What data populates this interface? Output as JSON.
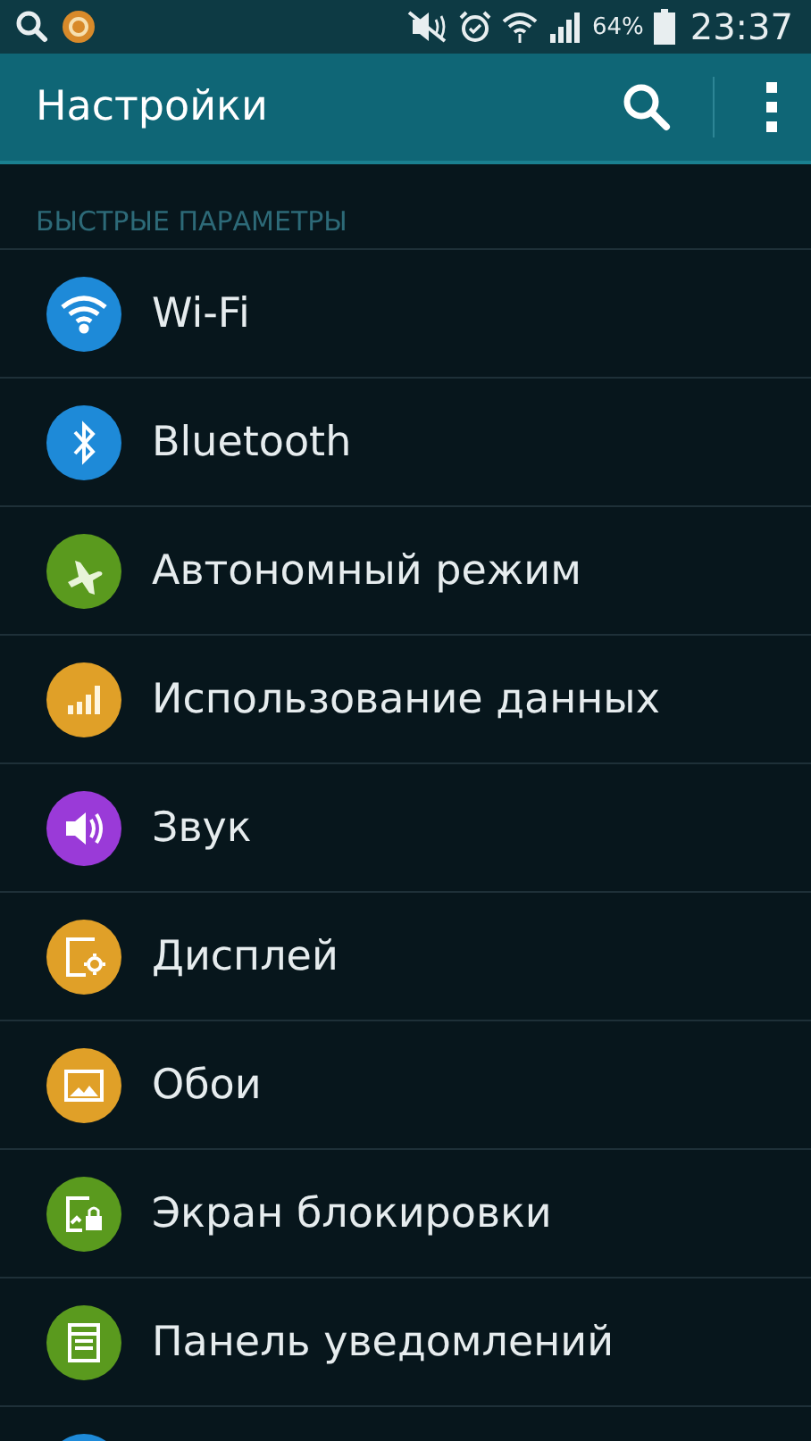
{
  "status_bar": {
    "battery_text": "64%",
    "time": "23:37"
  },
  "app_bar": {
    "title": "Настройки"
  },
  "section": {
    "title": "БЫСТРЫЕ ПАРАМЕТРЫ"
  },
  "items": [
    {
      "label": "Wi-Fi",
      "color": "#1e8ad8"
    },
    {
      "label": "Bluetooth",
      "color": "#1e8ad8"
    },
    {
      "label": "Автономный режим",
      "color": "#5a9a1e"
    },
    {
      "label": "Использование данных",
      "color": "#e0a028"
    },
    {
      "label": "Звук",
      "color": "#9a3ad8"
    },
    {
      "label": "Дисплей",
      "color": "#e0a028"
    },
    {
      "label": "Обои",
      "color": "#e0a028"
    },
    {
      "label": "Экран блокировки",
      "color": "#5a9a1e"
    },
    {
      "label": "Панель уведомлений",
      "color": "#5a9a1e"
    },
    {
      "color": "#1e8ad8"
    }
  ]
}
